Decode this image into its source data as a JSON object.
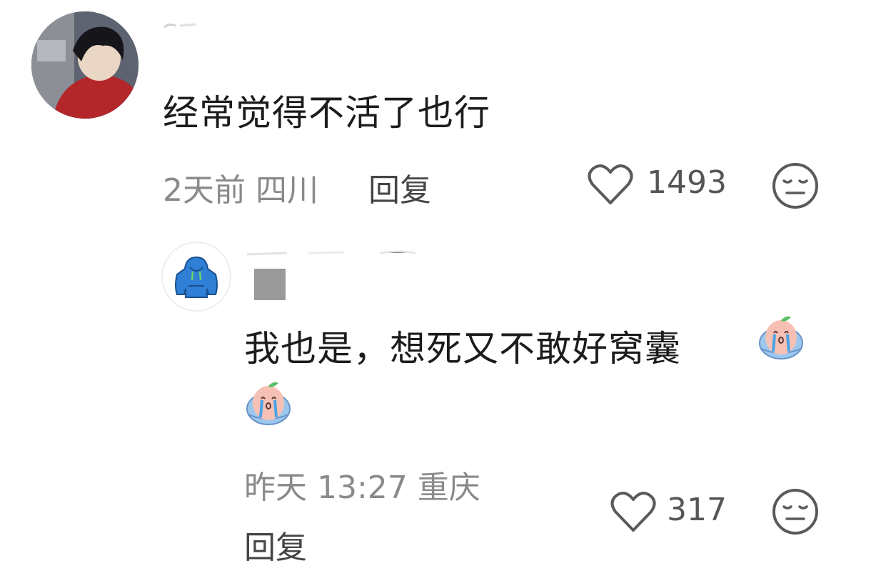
{
  "comment": {
    "text": "经常觉得不活了也行",
    "time": "2天前",
    "location": "四川",
    "reply_label": "回复",
    "likes": "1493"
  },
  "reply": {
    "text": "我也是，想死又不敢好窝囊",
    "time": "昨天 13:27",
    "location": "重庆",
    "reply_label": "回复",
    "likes": "317"
  },
  "icons": {
    "like": "heart-outline-icon",
    "dislike": "meh-face-icon",
    "emoji": "crying-peach-emoji"
  },
  "colors": {
    "text": "#1c1c1c",
    "meta": "#8a8a8a",
    "hoodie": "#2f7fd6"
  }
}
